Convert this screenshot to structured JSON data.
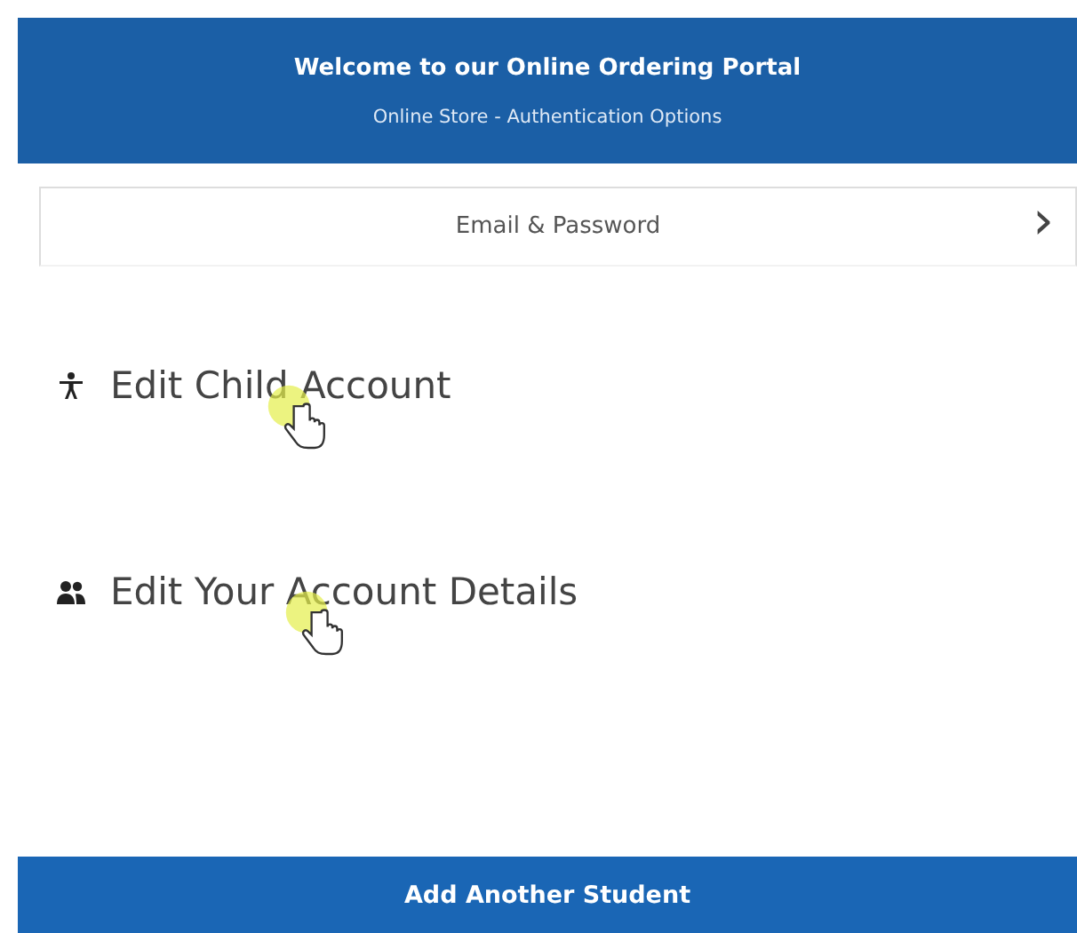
{
  "header": {
    "title": "Welcome to our Online Ordering Portal",
    "subtitle": "Online Store - Authentication Options"
  },
  "auth_option": {
    "label": "Email & Password",
    "chevron": "›"
  },
  "menu_items": [
    {
      "kind": "child",
      "label": "Edit Child Account"
    },
    {
      "kind": "account",
      "label": "Edit Your Account Details"
    }
  ],
  "button": {
    "label": "Add Another Student"
  }
}
